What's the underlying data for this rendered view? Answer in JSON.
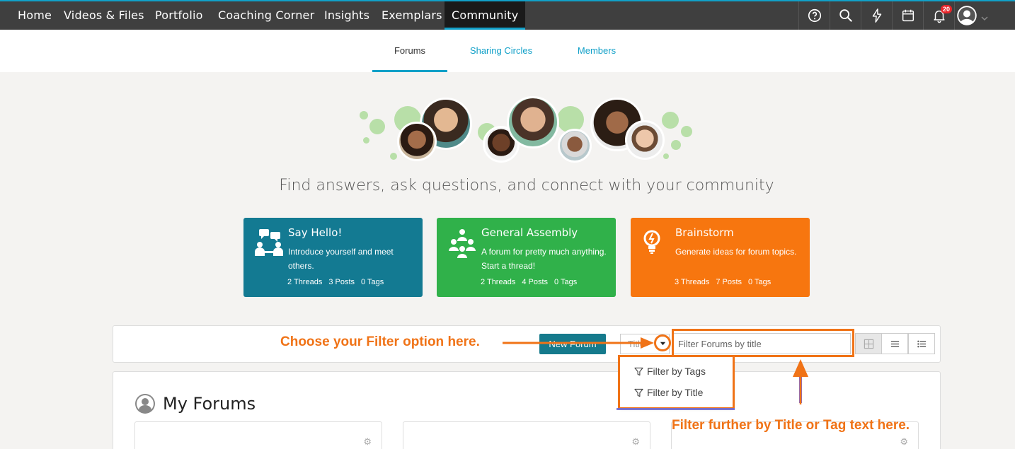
{
  "nav": {
    "items": [
      {
        "label": "Home"
      },
      {
        "label": "Videos & Files"
      },
      {
        "label": "Portfolio"
      },
      {
        "label": "Coaching Corner"
      },
      {
        "label": "Insights"
      },
      {
        "label": "Exemplars"
      },
      {
        "label": "Community"
      }
    ],
    "active": "Community",
    "notification_count": "20"
  },
  "subnav": {
    "tabs": [
      {
        "label": "Forums"
      },
      {
        "label": "Sharing Circles"
      },
      {
        "label": "Members"
      }
    ],
    "active": "Forums"
  },
  "hero": {
    "tagline": "Find answers, ask questions, and connect with your community"
  },
  "cards": [
    {
      "title": "Say Hello!",
      "desc": "Introduce yourself and meet others.",
      "threads": "2 Threads",
      "posts": "3 Posts",
      "tags": "0 Tags",
      "color": "#137a92",
      "icon": "chat-people-icon"
    },
    {
      "title": "General Assembly",
      "desc": "A forum for pretty much anything. Start a thread!",
      "threads": "2 Threads",
      "posts": "4 Posts",
      "tags": "0 Tags",
      "color": "#30b14a",
      "icon": "group-icon"
    },
    {
      "title": "Brainstorm",
      "desc": "Generate ideas for forum topics.",
      "threads": "3 Threads",
      "posts": "7 Posts",
      "tags": "0 Tags",
      "color": "#f7760f",
      "icon": "lightbulb-icon"
    }
  ],
  "toolbar": {
    "new_forum_label": "New Forum",
    "filter_selected": "Title",
    "filter_placeholder": "Filter Forums by title"
  },
  "dropdown": {
    "options": [
      {
        "label": "Filter by Tags"
      },
      {
        "label": "Filter by Title"
      }
    ]
  },
  "my_forums": {
    "title": "My Forums"
  },
  "annotations": {
    "filter_option": "Choose your Filter option here.",
    "filter_text": "Filter further by Title or Tag text here.",
    "color": "#f07317"
  }
}
